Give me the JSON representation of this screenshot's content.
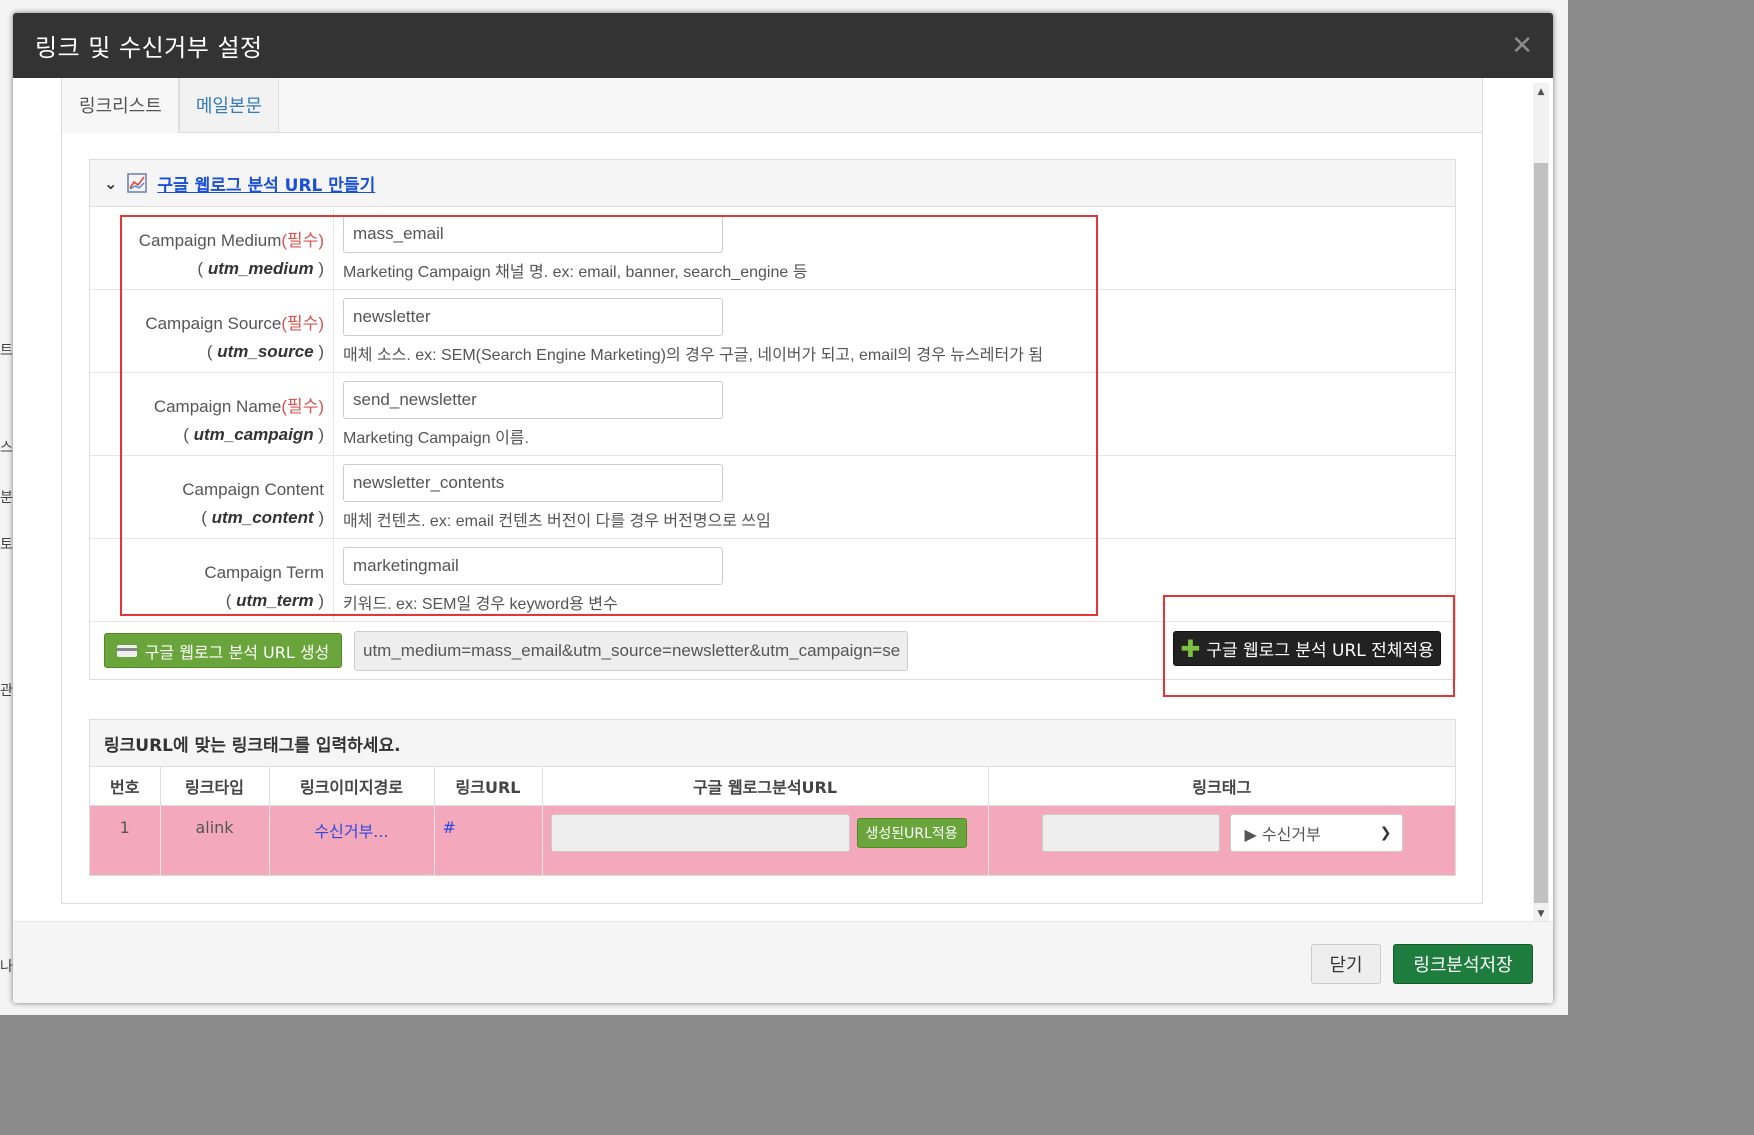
{
  "modal": {
    "title": "링크 및 수신거부 설정",
    "close_icon": "close-icon"
  },
  "tabs": [
    {
      "label": "링크리스트",
      "active": true
    },
    {
      "label": "메일본문",
      "active": false
    }
  ],
  "ga_section": {
    "title": "구글 웹로그 분석 URL 만들기",
    "required_mark": "(필수)",
    "fields": [
      {
        "label": "Campaign Medium",
        "required": true,
        "param": "utm_medium",
        "value": "mass_email",
        "help": "Marketing Campaign 채널 명. ex: email, banner, search_engine 등"
      },
      {
        "label": "Campaign Source",
        "required": true,
        "param": "utm_source",
        "value": "newsletter",
        "help": "매체 소스. ex: SEM(Search Engine Marketing)의 경우 구글, 네이버가 되고, email의 경우 뉴스레터가 됨"
      },
      {
        "label": "Campaign Name",
        "required": true,
        "param": "utm_campaign",
        "value": "send_newsletter",
        "help": "Marketing Campaign 이름."
      },
      {
        "label": "Campaign Content",
        "required": false,
        "param": "utm_content",
        "value": "newsletter_contents",
        "help": "매체 컨텐츠. ex: email 컨텐츠 버전이 다를 경우 버전명으로 쓰임"
      },
      {
        "label": "Campaign Term",
        "required": false,
        "param": "utm_term",
        "value": "marketingmail",
        "help": "키워드. ex: SEM일 경우 keyword용 변수"
      }
    ],
    "generate_button": "구글 웹로그 분석 URL 생성",
    "generated_url": "utm_medium=mass_email&utm_source=newsletter&utm_campaign=se",
    "apply_all_button": "구글 웹로그 분석 URL 전체적용"
  },
  "link_section": {
    "title": "링크URL에 맞는 링크태그를 입력하세요.",
    "columns": [
      "번호",
      "링크타입",
      "링크이미지경로",
      "링크URL",
      "구글 웹로그분석URL",
      "링크태그"
    ],
    "rows": [
      {
        "no": "1",
        "type": "alink",
        "image_path": "수신거부...",
        "url": "#",
        "apply_label": "생성된URL적용",
        "select_value": "▶ 수신거부"
      }
    ]
  },
  "footer": {
    "close_button": "닫기",
    "save_button": "링크분석저장"
  },
  "colors": {
    "header_bg": "#333333",
    "row_highlight": "#f3a8bb",
    "green_button": "#6aa53c",
    "save_button": "#1e7d3e",
    "annotation_red": "#e53535",
    "link_blue": "#1a4fd8"
  },
  "background": {
    "chars": [
      "트",
      "스",
      "분",
      "토",
      "관",
      "나"
    ]
  }
}
